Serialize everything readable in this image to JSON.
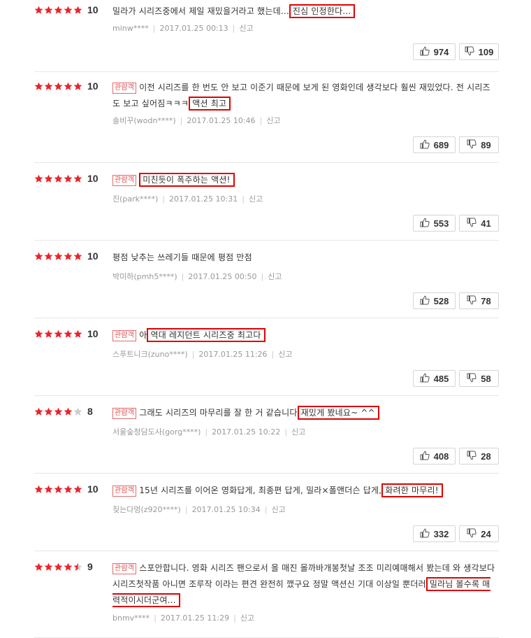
{
  "colors": {
    "star_on": "#e8242b",
    "star_off": "#cccccc",
    "highlight": "#e00000",
    "badge": "#e35050"
  },
  "reviews": [
    {
      "stars": 5,
      "score": "10",
      "badge": "",
      "text_before": "밀라가 시리즈중에서 제일 재밌을거라고 했는데...",
      "highlight": "진심 인정한다...",
      "text_after": "",
      "author": "minw****",
      "date": "2017.01.25 00:13",
      "report": "신고",
      "likes": "974",
      "dislikes": "109"
    },
    {
      "stars": 5,
      "score": "10",
      "badge": "관람객",
      "text_before": "이전 시리즈를 한 번도 안 보고 이준기 때문에 보게 된 영화인데 생각보다 훨씬 재밌었다. 전 시리즈도 보고 싶어짐ㅋㅋㅋ",
      "highlight": "액션 최고",
      "text_after": "",
      "author": "솔비꾸(wodn****)",
      "date": "2017.01.25 10:46",
      "report": "신고",
      "likes": "689",
      "dislikes": "89"
    },
    {
      "stars": 5,
      "score": "10",
      "badge": "관람객",
      "text_before": "",
      "highlight": "미친듯이 폭주하는 액션!",
      "text_after": "",
      "author": "진(park****)",
      "date": "2017.01.25 10:31",
      "report": "신고",
      "likes": "553",
      "dislikes": "41"
    },
    {
      "stars": 5,
      "score": "10",
      "badge": "",
      "text_before": "평점 낮추는 쓰레기들 때문에 평점 만점",
      "highlight": "",
      "text_after": "",
      "author": "박미하(pmh5****)",
      "date": "2017.01.25 00:50",
      "report": "신고",
      "likes": "528",
      "dislikes": "78"
    },
    {
      "stars": 5,
      "score": "10",
      "badge": "관람객",
      "text_before": "아",
      "highlight": "역대 레지던트 시리즈중 최고다",
      "text_after": "",
      "author": "스푸트니크(zuno****)",
      "date": "2017.01.25 11:26",
      "report": "신고",
      "likes": "485",
      "dislikes": "58"
    },
    {
      "stars": 4,
      "score": "8",
      "badge": "관람객",
      "text_before": "그래도 시리즈의 마무리를 잘 한 거 같습니다",
      "highlight": "재밌게 봤네요~ ^^",
      "text_after": "",
      "author": "서울숲청담도사(gorg****)",
      "date": "2017.01.25 10:22",
      "report": "신고",
      "likes": "408",
      "dislikes": "28"
    },
    {
      "stars": 5,
      "score": "10",
      "badge": "관람객",
      "text_before": "15년 시리즈를 이어온 영화답게, 최종편 답게, 밀라×폴앤더슨 답게,",
      "highlight": "화려한 마무리!",
      "text_after": "",
      "author": "짖는다멍(z920****)",
      "date": "2017.01.25 10:34",
      "report": "신고",
      "likes": "332",
      "dislikes": "24"
    },
    {
      "stars": 4.5,
      "score": "9",
      "badge": "관람객",
      "text_before": "스포안합니다. 영화 시리즈 팬으로서 올 매진 몰까바개봉첫날 조조 미리예매해서 봤는데 와 생각보다 시리즈첫작품 아니면 조루작 이라는 편견 완전히 깼구요 정말 액션신 기대 이상일 뿐더러",
      "highlight": "밀라님 볼수록 매력적이시더군여...",
      "text_after": "",
      "author": "bnmv****",
      "date": "2017.01.25 11:29",
      "report": "신고",
      "likes": "",
      "dislikes": ""
    }
  ]
}
